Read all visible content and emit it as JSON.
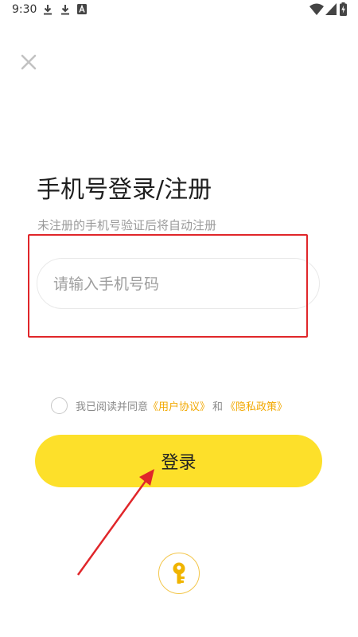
{
  "status_bar": {
    "time": "9:30",
    "left_icons": [
      "download-icon",
      "download-icon",
      "font-app-icon"
    ],
    "right_icons": [
      "wifi-icon",
      "signal-icon",
      "battery-charging-icon"
    ]
  },
  "close_icon": "close-icon",
  "title": "手机号登录/注册",
  "subtitle": "未注册的手机号验证后将自动注册",
  "phone_input": {
    "placeholder": "请输入手机号码",
    "value": ""
  },
  "agreement": {
    "prefix": "我已阅读并同意",
    "user_agreement": "《用户协议》",
    "and": "和",
    "privacy_policy": "《隐私政策》",
    "checked": false
  },
  "login_button": {
    "label": "登录"
  },
  "key_icon": "key-icon",
  "colors": {
    "accent_yellow": "#fde02a",
    "link_orange": "#f2a800",
    "annotation_red": "#e0262a",
    "subtitle_gray": "#9a9a9a"
  }
}
